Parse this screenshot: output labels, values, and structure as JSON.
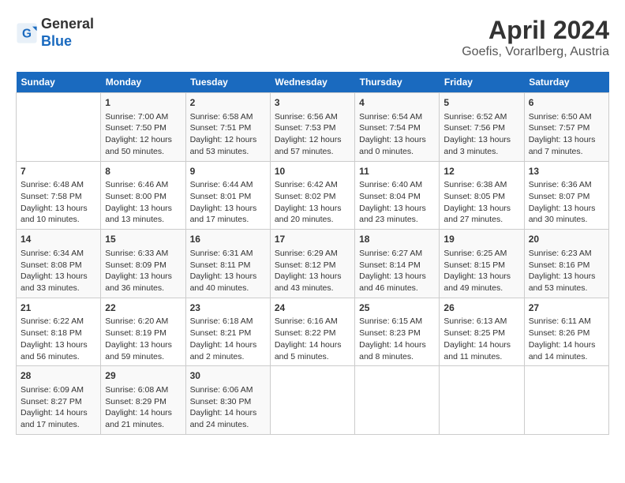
{
  "header": {
    "logo_line1": "General",
    "logo_line2": "Blue",
    "title": "April 2024",
    "subtitle": "Goefis, Vorarlberg, Austria"
  },
  "calendar": {
    "days_of_week": [
      "Sunday",
      "Monday",
      "Tuesday",
      "Wednesday",
      "Thursday",
      "Friday",
      "Saturday"
    ],
    "weeks": [
      [
        {
          "day": "",
          "info": ""
        },
        {
          "day": "1",
          "info": "Sunrise: 7:00 AM\nSunset: 7:50 PM\nDaylight: 12 hours\nand 50 minutes."
        },
        {
          "day": "2",
          "info": "Sunrise: 6:58 AM\nSunset: 7:51 PM\nDaylight: 12 hours\nand 53 minutes."
        },
        {
          "day": "3",
          "info": "Sunrise: 6:56 AM\nSunset: 7:53 PM\nDaylight: 12 hours\nand 57 minutes."
        },
        {
          "day": "4",
          "info": "Sunrise: 6:54 AM\nSunset: 7:54 PM\nDaylight: 13 hours\nand 0 minutes."
        },
        {
          "day": "5",
          "info": "Sunrise: 6:52 AM\nSunset: 7:56 PM\nDaylight: 13 hours\nand 3 minutes."
        },
        {
          "day": "6",
          "info": "Sunrise: 6:50 AM\nSunset: 7:57 PM\nDaylight: 13 hours\nand 7 minutes."
        }
      ],
      [
        {
          "day": "7",
          "info": "Sunrise: 6:48 AM\nSunset: 7:58 PM\nDaylight: 13 hours\nand 10 minutes."
        },
        {
          "day": "8",
          "info": "Sunrise: 6:46 AM\nSunset: 8:00 PM\nDaylight: 13 hours\nand 13 minutes."
        },
        {
          "day": "9",
          "info": "Sunrise: 6:44 AM\nSunset: 8:01 PM\nDaylight: 13 hours\nand 17 minutes."
        },
        {
          "day": "10",
          "info": "Sunrise: 6:42 AM\nSunset: 8:02 PM\nDaylight: 13 hours\nand 20 minutes."
        },
        {
          "day": "11",
          "info": "Sunrise: 6:40 AM\nSunset: 8:04 PM\nDaylight: 13 hours\nand 23 minutes."
        },
        {
          "day": "12",
          "info": "Sunrise: 6:38 AM\nSunset: 8:05 PM\nDaylight: 13 hours\nand 27 minutes."
        },
        {
          "day": "13",
          "info": "Sunrise: 6:36 AM\nSunset: 8:07 PM\nDaylight: 13 hours\nand 30 minutes."
        }
      ],
      [
        {
          "day": "14",
          "info": "Sunrise: 6:34 AM\nSunset: 8:08 PM\nDaylight: 13 hours\nand 33 minutes."
        },
        {
          "day": "15",
          "info": "Sunrise: 6:33 AM\nSunset: 8:09 PM\nDaylight: 13 hours\nand 36 minutes."
        },
        {
          "day": "16",
          "info": "Sunrise: 6:31 AM\nSunset: 8:11 PM\nDaylight: 13 hours\nand 40 minutes."
        },
        {
          "day": "17",
          "info": "Sunrise: 6:29 AM\nSunset: 8:12 PM\nDaylight: 13 hours\nand 43 minutes."
        },
        {
          "day": "18",
          "info": "Sunrise: 6:27 AM\nSunset: 8:14 PM\nDaylight: 13 hours\nand 46 minutes."
        },
        {
          "day": "19",
          "info": "Sunrise: 6:25 AM\nSunset: 8:15 PM\nDaylight: 13 hours\nand 49 minutes."
        },
        {
          "day": "20",
          "info": "Sunrise: 6:23 AM\nSunset: 8:16 PM\nDaylight: 13 hours\nand 53 minutes."
        }
      ],
      [
        {
          "day": "21",
          "info": "Sunrise: 6:22 AM\nSunset: 8:18 PM\nDaylight: 13 hours\nand 56 minutes."
        },
        {
          "day": "22",
          "info": "Sunrise: 6:20 AM\nSunset: 8:19 PM\nDaylight: 13 hours\nand 59 minutes."
        },
        {
          "day": "23",
          "info": "Sunrise: 6:18 AM\nSunset: 8:21 PM\nDaylight: 14 hours\nand 2 minutes."
        },
        {
          "day": "24",
          "info": "Sunrise: 6:16 AM\nSunset: 8:22 PM\nDaylight: 14 hours\nand 5 minutes."
        },
        {
          "day": "25",
          "info": "Sunrise: 6:15 AM\nSunset: 8:23 PM\nDaylight: 14 hours\nand 8 minutes."
        },
        {
          "day": "26",
          "info": "Sunrise: 6:13 AM\nSunset: 8:25 PM\nDaylight: 14 hours\nand 11 minutes."
        },
        {
          "day": "27",
          "info": "Sunrise: 6:11 AM\nSunset: 8:26 PM\nDaylight: 14 hours\nand 14 minutes."
        }
      ],
      [
        {
          "day": "28",
          "info": "Sunrise: 6:09 AM\nSunset: 8:27 PM\nDaylight: 14 hours\nand 17 minutes."
        },
        {
          "day": "29",
          "info": "Sunrise: 6:08 AM\nSunset: 8:29 PM\nDaylight: 14 hours\nand 21 minutes."
        },
        {
          "day": "30",
          "info": "Sunrise: 6:06 AM\nSunset: 8:30 PM\nDaylight: 14 hours\nand 24 minutes."
        },
        {
          "day": "",
          "info": ""
        },
        {
          "day": "",
          "info": ""
        },
        {
          "day": "",
          "info": ""
        },
        {
          "day": "",
          "info": ""
        }
      ]
    ]
  }
}
